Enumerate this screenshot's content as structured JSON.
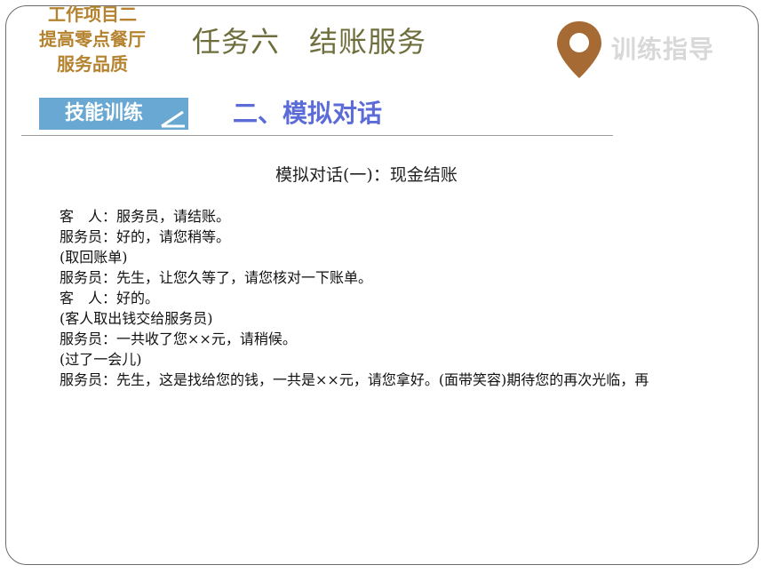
{
  "header": {
    "project_lines": [
      "工作项目二",
      "提高零点餐厅",
      "服务品质"
    ],
    "task_title": "任务六　结账服务",
    "guide_label": "训练指导",
    "pin_color": "#a66b35"
  },
  "section": {
    "skill_label": "技能训练",
    "title": "二、模拟对话"
  },
  "dialog": {
    "title": "模拟对话(一)：现金结账",
    "lines": [
      "客　人：服务员，请结账。",
      "服务员：好的，请您稍等。",
      "(取回账单)",
      "服务员：先生，让您久等了，请您核对一下账单。",
      "客　人：好的。",
      "(客人取出钱交给服务员)",
      "服务员：一共收了您××元，请稍候。",
      "(过了一会儿)",
      "服务员：先生，这是找给您的钱，一共是××元，请您拿好。(面带笑容)期待您的再次光临，再"
    ]
  }
}
